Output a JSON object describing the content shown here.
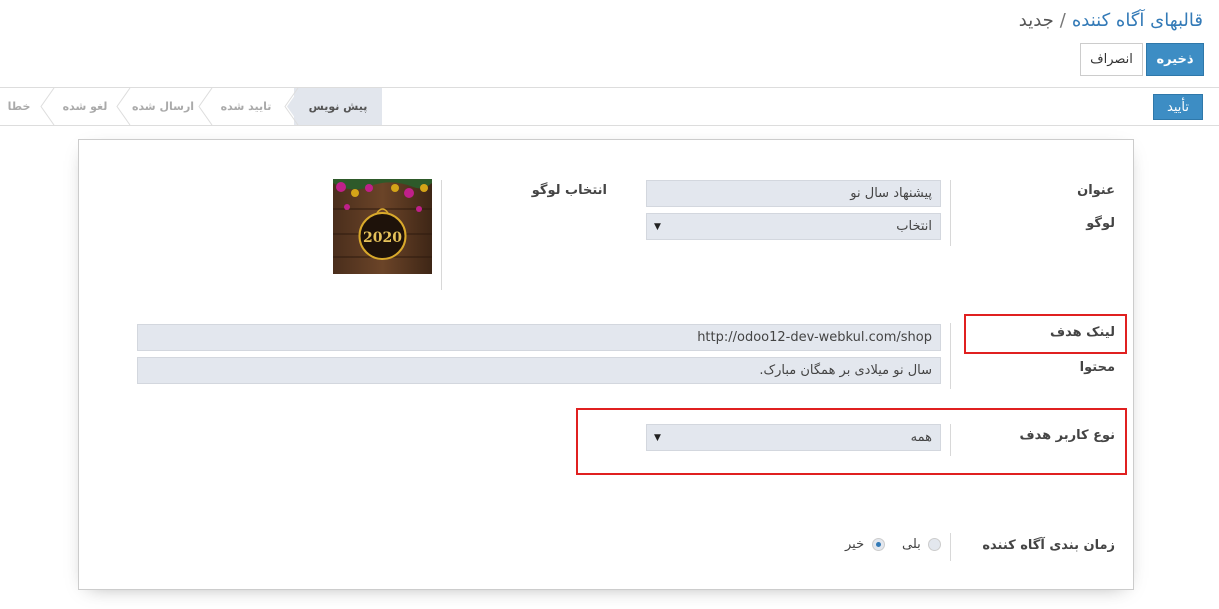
{
  "breadcrumb": {
    "parent": "قالبهای آگاه کننده",
    "separator": "/",
    "current": "جدید"
  },
  "actions": {
    "save_label": "ذخیره",
    "discard_label": "انصراف"
  },
  "statusbar": {
    "confirm_label": "تأیید",
    "stages": [
      {
        "label": "پیش نویس",
        "active": true
      },
      {
        "label": "تایید شده",
        "active": false
      },
      {
        "label": "ارسال شده",
        "active": false
      },
      {
        "label": "لغو شده",
        "active": false
      },
      {
        "label": "خطا",
        "active": false
      }
    ]
  },
  "form": {
    "title_label": "عنوان",
    "title_value": "پیشنهاد سال نو",
    "logo_label": "لوگو",
    "logo_value": "انتخاب",
    "choose_logo_label": "انتخاب لوگو",
    "logo_image_text": "2020",
    "target_link_label": "لینک هدف",
    "target_link_value": "http://odoo12-dev-webkul.com/shop",
    "content_label": "محتوا",
    "content_value": "سال نو میلادی بر همگان مبارک.",
    "target_user_type_label": "نوع کاربر هدف",
    "target_user_type_value": "همه",
    "scheduling_label": "زمان بندی آگاه کننده",
    "scheduling_options": [
      {
        "label": "بلی",
        "checked": false
      },
      {
        "label": "خیر",
        "checked": true
      }
    ]
  },
  "colors": {
    "primary": "#3d8dc4",
    "link": "#337ab7",
    "highlight": "#e02020",
    "field_bg": "#e3e7ee"
  },
  "icons": {
    "select_caret": "caret-down-icon",
    "stage_chevron": "chevron-left-icon"
  }
}
